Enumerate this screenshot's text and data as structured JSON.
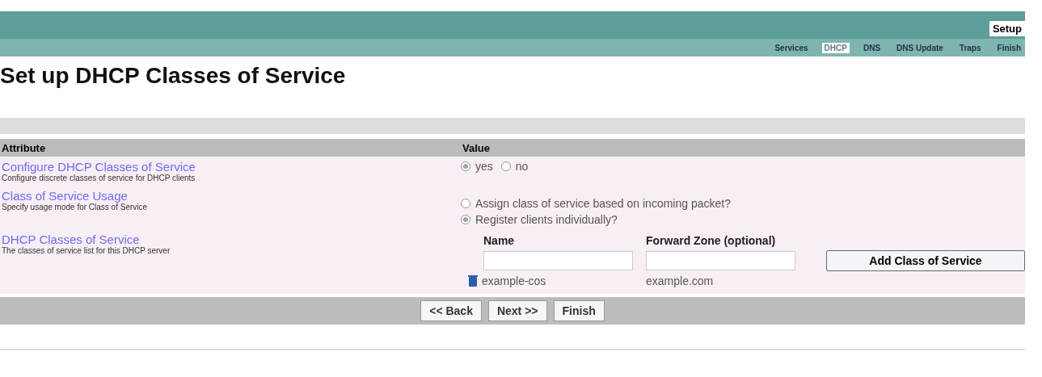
{
  "header": {
    "section": "Setup",
    "tabs": [
      {
        "label": "Services",
        "selected": false
      },
      {
        "label": "DHCP",
        "selected": true
      },
      {
        "label": "DNS",
        "selected": false
      },
      {
        "label": "DNS Update",
        "selected": false
      },
      {
        "label": "Traps",
        "selected": false
      },
      {
        "label": "Finish",
        "selected": false
      }
    ]
  },
  "title": "Set up DHCP Classes of Service",
  "table": {
    "columns": [
      "Attribute",
      "Value"
    ],
    "rows": [
      {
        "kind": "radios",
        "inline": true,
        "label": "Configure DHCP Classes of Service",
        "description": "Configure discrete classes of service for DHCP clients",
        "options": [
          {
            "label": "yes",
            "selected": true
          },
          {
            "label": "no",
            "selected": false
          }
        ]
      },
      {
        "kind": "radios",
        "inline": false,
        "label": "Class of Service Usage",
        "description": "Specify usage mode for Class of Service",
        "options": [
          {
            "label": "Assign class of service based on incoming packet?",
            "selected": false
          },
          {
            "label": "Register clients individually?",
            "selected": true
          }
        ]
      },
      {
        "kind": "list",
        "label": "DHCP Classes of Service",
        "description": "The classes of service list for this DHCP server",
        "name_label": "Name",
        "zone_label": "Forward Zone (optional)",
        "add_button": "Add Class of Service",
        "entries": [
          {
            "name": "example-cos",
            "zone": "example.com"
          }
        ]
      }
    ]
  },
  "buttons": [
    "<< Back",
    "Next >>",
    "Finish"
  ]
}
